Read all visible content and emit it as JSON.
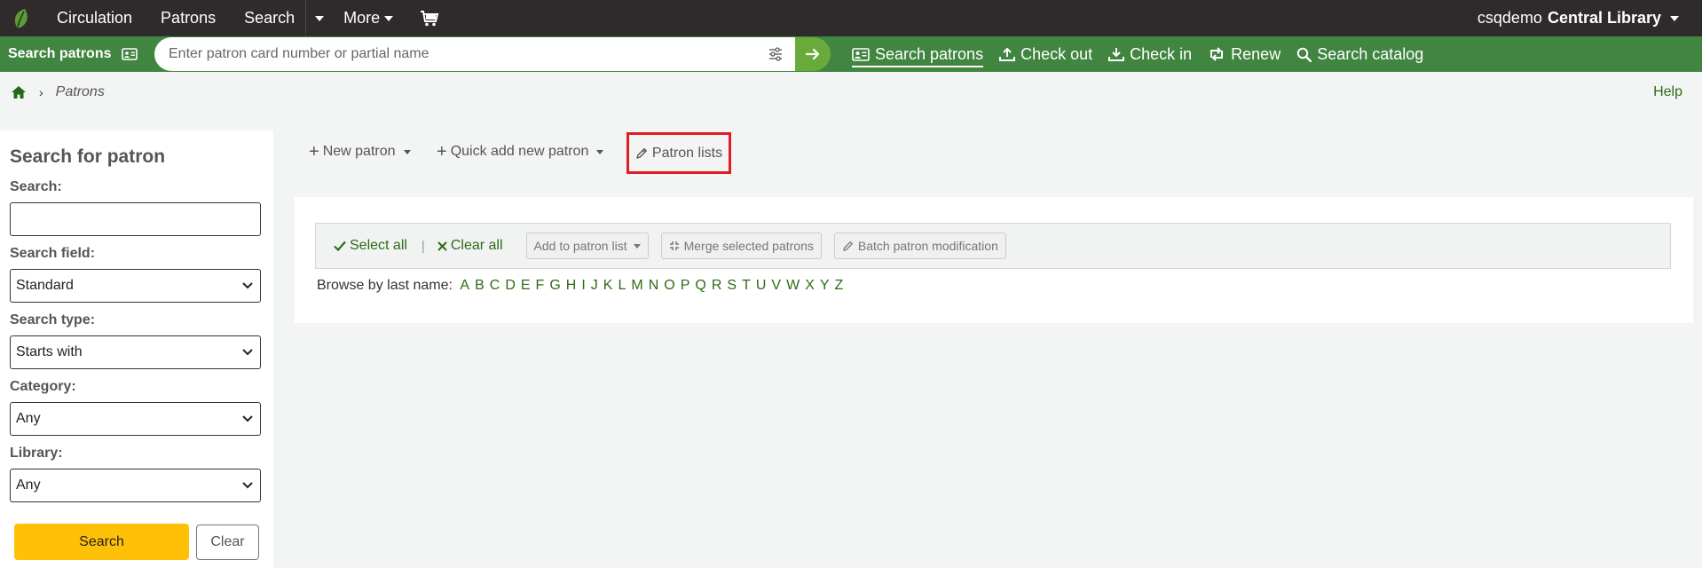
{
  "topnav": {
    "items": [
      "Circulation",
      "Patrons",
      "Search"
    ],
    "more_label": "More",
    "user": "csqdemo",
    "library": "Central Library"
  },
  "searchbar": {
    "label": "Search patrons",
    "placeholder": "Enter patron card number or partial name",
    "links": [
      "Search patrons",
      "Check out",
      "Check in",
      "Renew",
      "Search catalog"
    ]
  },
  "breadcrumb": {
    "current": "Patrons"
  },
  "help_label": "Help",
  "sidebar": {
    "title": "Search for patron",
    "search_label": "Search:",
    "search_value": "",
    "field_label": "Search field:",
    "field_value": "Standard",
    "type_label": "Search type:",
    "type_value": "Starts with",
    "category_label": "Category:",
    "category_value": "Any",
    "library_label": "Library:",
    "library_value": "Any",
    "search_button": "Search",
    "clear_button": "Clear"
  },
  "toolbar": {
    "new_patron": "New patron",
    "quick_add": "Quick add new patron",
    "patron_lists": "Patron lists"
  },
  "actions": {
    "select_all": "Select all",
    "separator": "|",
    "clear_all": "Clear all",
    "add_to_list": "Add to patron list",
    "merge": "Merge selected patrons",
    "batch": "Batch patron modification"
  },
  "browse": {
    "label": "Browse by last name:",
    "letters": [
      "A",
      "B",
      "C",
      "D",
      "E",
      "F",
      "G",
      "H",
      "I",
      "J",
      "K",
      "L",
      "M",
      "N",
      "O",
      "P",
      "Q",
      "R",
      "S",
      "T",
      "U",
      "V",
      "W",
      "X",
      "Y",
      "Z"
    ]
  },
  "colors": {
    "topnav_bg": "#2f2a2b",
    "search_green": "#408540",
    "link_green": "#2e6b15",
    "search_button": "#ffc107",
    "highlight_red": "#e01b24"
  }
}
